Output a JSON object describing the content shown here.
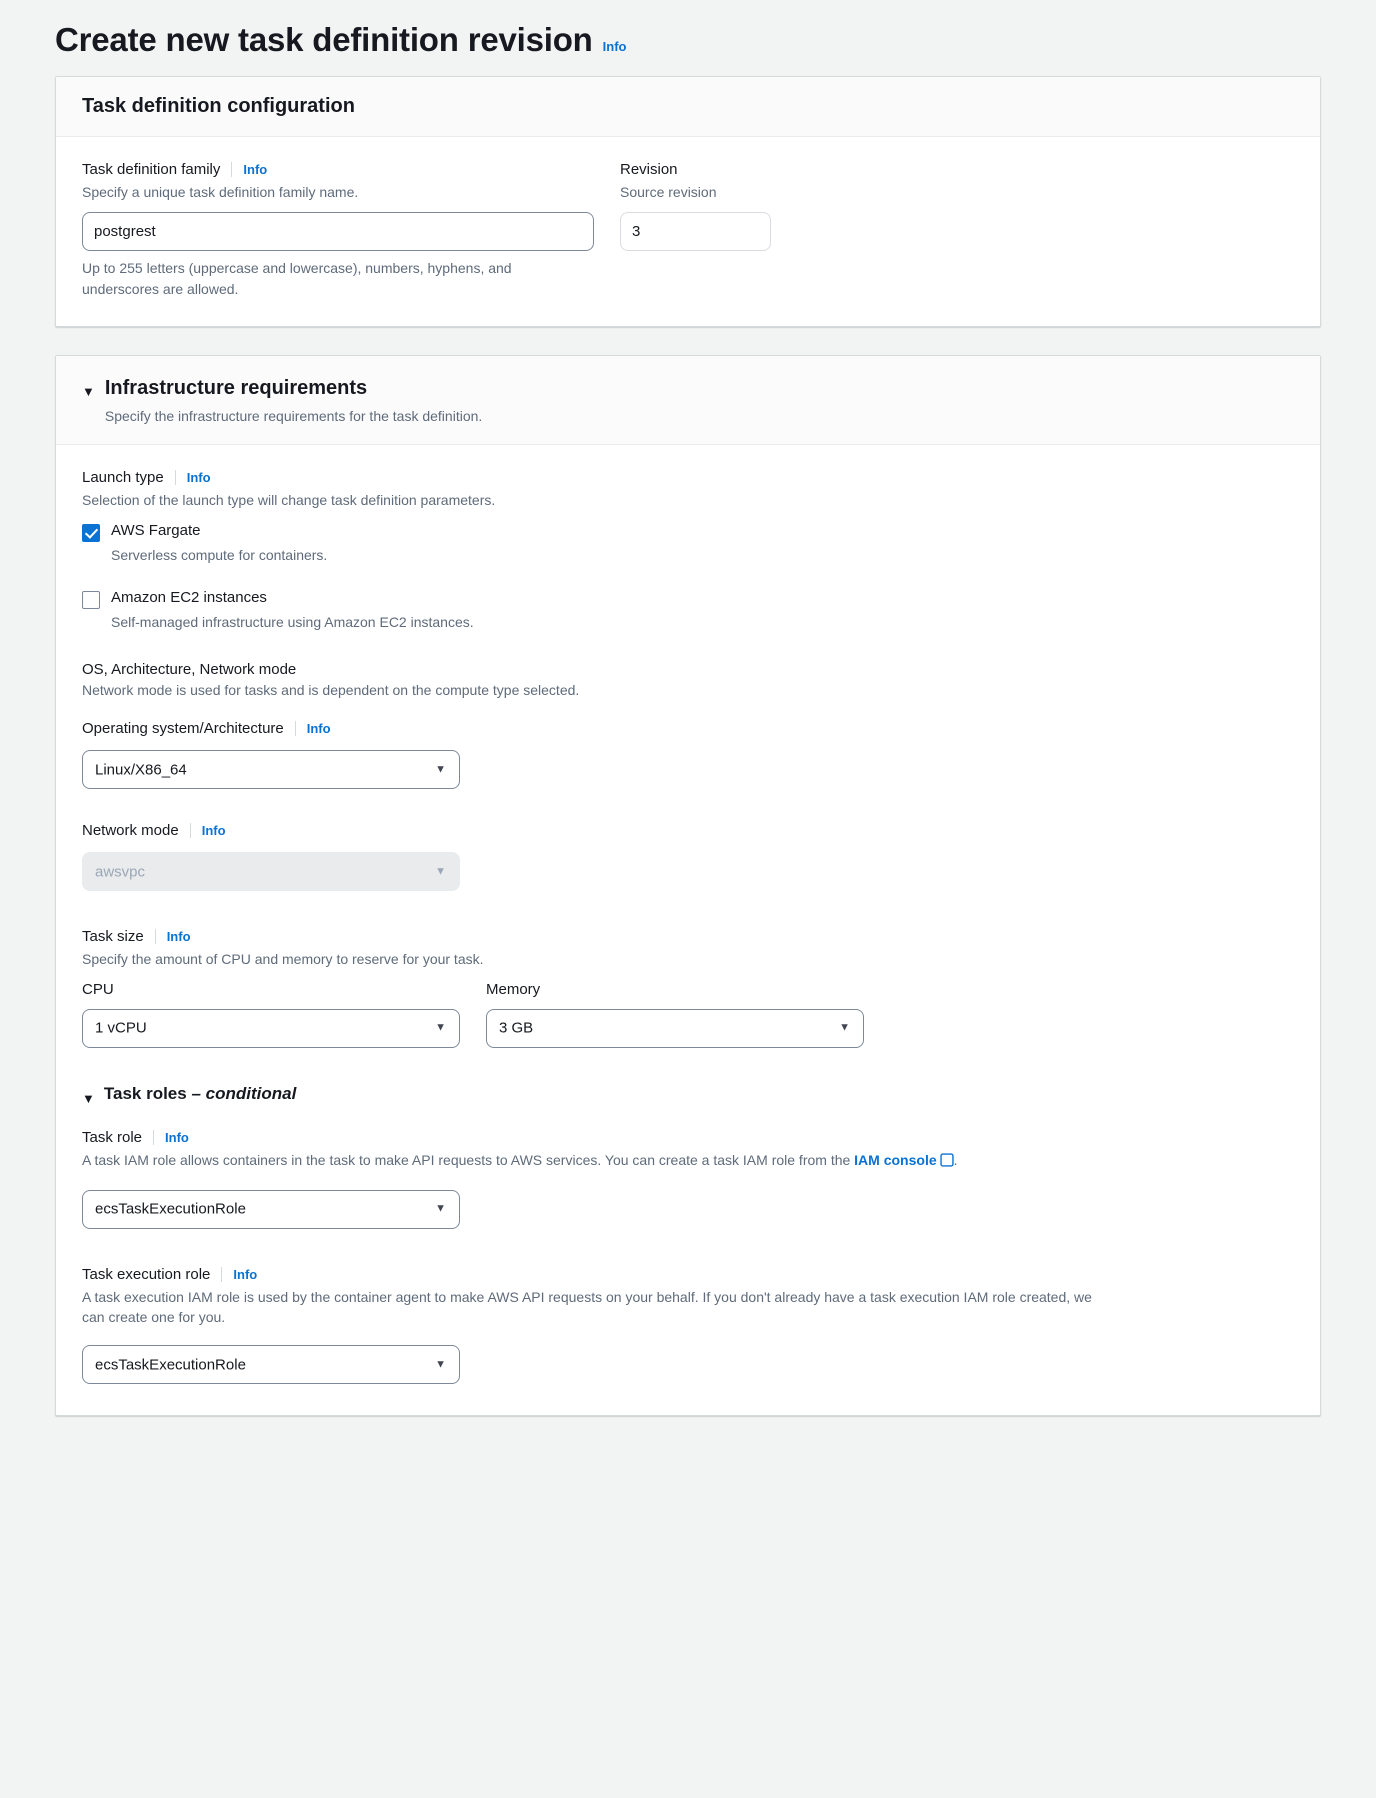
{
  "page": {
    "title": "Create new task definition revision",
    "info_label": "Info"
  },
  "task_definition_configuration": {
    "card_title": "Task definition configuration",
    "family": {
      "label": "Task definition family",
      "info_label": "Info",
      "description": "Specify a unique task definition family name.",
      "value": "postgrest",
      "constraint": "Up to 255 letters (uppercase and lowercase), numbers, hyphens, and underscores are allowed."
    },
    "revision": {
      "label": "Revision",
      "description": "Source revision",
      "value": "3"
    }
  },
  "infrastructure_requirements": {
    "caret": "▼",
    "title": "Infrastructure requirements",
    "description": "Specify the infrastructure requirements for the task definition.",
    "launch_type": {
      "label": "Launch type",
      "info_label": "Info",
      "description": "Selection of the launch type will change task definition parameters.",
      "options": [
        {
          "label": "AWS Fargate",
          "sub": "Serverless compute for containers.",
          "checked": true
        },
        {
          "label": "Amazon EC2 instances",
          "sub": "Self-managed infrastructure using Amazon EC2 instances.",
          "checked": false
        }
      ]
    },
    "os_arch_network": {
      "heading": "OS, Architecture, Network mode",
      "description": "Network mode is used for tasks and is dependent on the compute type selected.",
      "operating_system": {
        "label": "Operating system/Architecture",
        "info_label": "Info",
        "value": "Linux/X86_64",
        "arrow": "▼"
      },
      "network_mode": {
        "label": "Network mode",
        "info_label": "Info",
        "value": "awsvpc",
        "arrow": "▼",
        "disabled": true
      }
    },
    "task_size": {
      "label": "Task size",
      "info_label": "Info",
      "description": "Specify the amount of CPU and memory to reserve for your task.",
      "cpu": {
        "label": "CPU",
        "value": "1 vCPU",
        "arrow": "▼"
      },
      "memory": {
        "label": "Memory",
        "value": "3 GB",
        "arrow": "▼"
      }
    },
    "task_roles": {
      "caret": "▼",
      "title": "Task roles ",
      "title_em": "– conditional",
      "task_role": {
        "label": "Task role",
        "info_label": "Info",
        "description_before": "A task IAM role allows containers in the task to make API requests to AWS services. You can create a task IAM role from the ",
        "link_label": "IAM console",
        "description_after": ".",
        "value": "ecsTaskExecutionRole",
        "arrow": "▼"
      },
      "task_execution_role": {
        "label": "Task execution role",
        "info_label": "Info",
        "description": "A task execution IAM role is used by the container agent to make AWS API requests on your behalf. If you don't already have a task execution IAM role created, we can create one for you.",
        "value": "ecsTaskExecutionRole",
        "arrow": "▼"
      }
    }
  }
}
